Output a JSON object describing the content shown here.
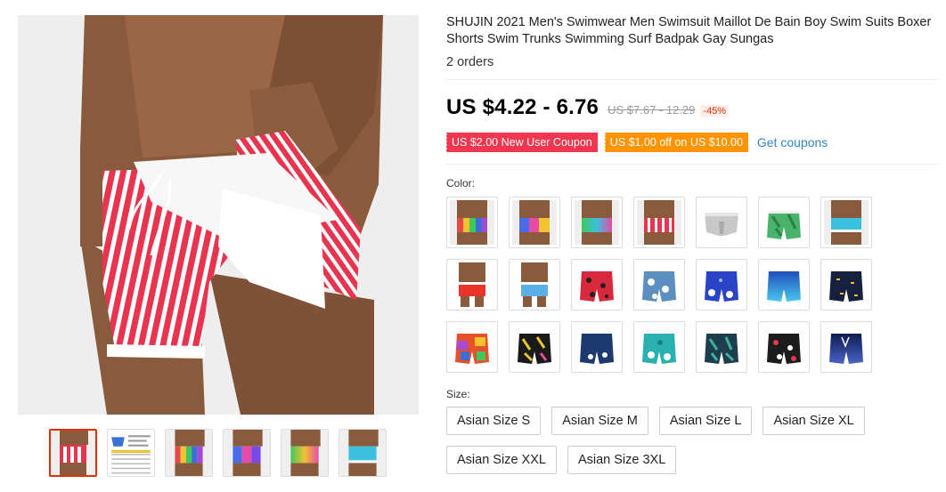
{
  "product": {
    "title": "SHUJIN 2021 Men's Swimwear Men Swimsuit Maillot De Bain Boy Swim Suits Boxer Shorts Swim Trunks Swimming Surf Badpak Gay Sungas",
    "orders": "2 orders"
  },
  "price": {
    "current": "US $4.22 - 6.76",
    "original": "US $7.67 - 12.29",
    "discount": "-45%"
  },
  "coupons": {
    "new_user": "US $2.00 New User Coupon",
    "store": "US $1.00 off on US $10.00",
    "get_link": "Get coupons"
  },
  "color_section": {
    "label": "Color:",
    "swatches": [
      "brief-rainbow-stripe-icon",
      "brief-blue-pink-stripe-icon",
      "brief-rainbow-gradient-icon",
      "brief-red-white-stripe-icon",
      "brief-grey-icon",
      "shorts-green-tropical-icon",
      "brief-cyan-icon",
      "brief-red-model-icon",
      "brief-blue-model-icon",
      "shorts-red-floral-icon",
      "shorts-blue-white-floral-icon",
      "shorts-royal-blue-floral-icon",
      "shorts-blue-gradient-icon",
      "shorts-navy-pattern-icon",
      "shorts-multicolor-icon",
      "shorts-neon-palm-icon",
      "shorts-navy-white-icon",
      "shorts-teal-floral-icon",
      "shorts-teal-leaf-icon",
      "shorts-black-red-floral-icon",
      "shorts-navy-gradient-icon"
    ]
  },
  "size_section": {
    "label": "Size:",
    "options": [
      "Asian Size S",
      "Asian Size M",
      "Asian Size L",
      "Asian Size XL",
      "Asian Size XXL",
      "Asian Size 3XL"
    ]
  },
  "gallery": {
    "main_image": "model-red-stripe-swim-brief-photo",
    "thumbnails": [
      "red-stripe-brief-thumb",
      "size-chart-thumb",
      "rainbow-brief-thumb",
      "blue-pink-brief-thumb",
      "rainbow-gradient-brief-thumb",
      "cyan-brief-thumb"
    ]
  },
  "colors": {
    "price_text": "#000000",
    "discount": "#e62e04",
    "coupon_red": "#f0374f",
    "coupon_orange": "#ff9300",
    "link": "#2e87c8",
    "active_thumb_border": "#e62e04"
  }
}
